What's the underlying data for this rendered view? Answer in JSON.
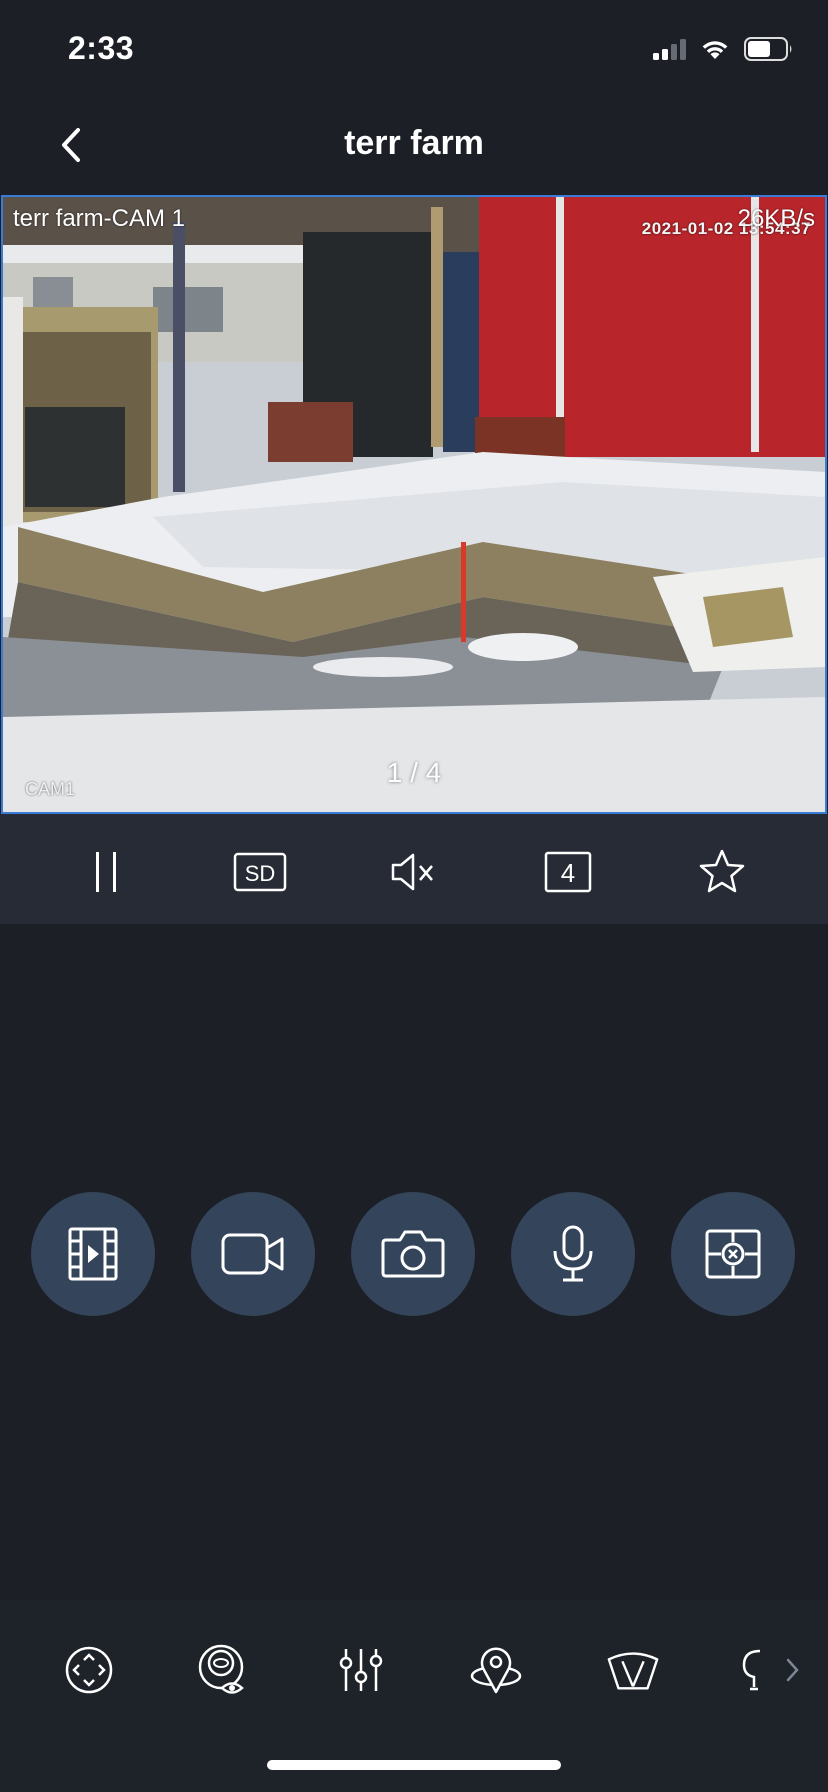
{
  "status_bar": {
    "time": "2:33",
    "icons": [
      "cellular-signal-icon",
      "wifi-icon",
      "battery-icon"
    ]
  },
  "nav": {
    "title": "terr farm",
    "back_icon": "chevron-left-icon"
  },
  "video": {
    "camera_label": "terr farm-CAM 1",
    "bitrate": "26KB/s",
    "osd_date": "2021-01-02 13:54:37",
    "osd_camera": "CAM1",
    "page_indicator": "1 / 4",
    "border_color": "#3a7bd5"
  },
  "video_toolbar": {
    "items": [
      {
        "name": "pause",
        "icon": "pause-icon",
        "label": ""
      },
      {
        "name": "quality",
        "icon": "sd-quality-icon",
        "label": "SD"
      },
      {
        "name": "mute",
        "icon": "speaker-muted-icon",
        "label": ""
      },
      {
        "name": "split",
        "icon": "split-screen-icon",
        "label": "4"
      },
      {
        "name": "favorite",
        "icon": "star-icon",
        "label": ""
      }
    ]
  },
  "actions": {
    "items": [
      {
        "name": "playback",
        "icon": "film-play-icon"
      },
      {
        "name": "record",
        "icon": "video-camera-icon"
      },
      {
        "name": "snapshot",
        "icon": "camera-icon"
      },
      {
        "name": "talk",
        "icon": "microphone-icon"
      },
      {
        "name": "alarm",
        "icon": "alarm-target-icon"
      }
    ],
    "button_color": "#34445a"
  },
  "ptz_bar": {
    "items": [
      {
        "name": "ptz-direction",
        "icon": "ptz-direction-icon"
      },
      {
        "name": "eye-view",
        "icon": "eye-view-icon"
      },
      {
        "name": "image-adjust",
        "icon": "sliders-icon"
      },
      {
        "name": "preset",
        "icon": "location-pin-icon"
      },
      {
        "name": "wiper",
        "icon": "wiper-icon"
      },
      {
        "name": "partial",
        "icon": "partial-icon"
      }
    ],
    "more_icon": "chevron-right-icon"
  },
  "colors": {
    "background": "#1c1f26",
    "toolbar": "#262b35",
    "accent": "#3a7bd5"
  }
}
